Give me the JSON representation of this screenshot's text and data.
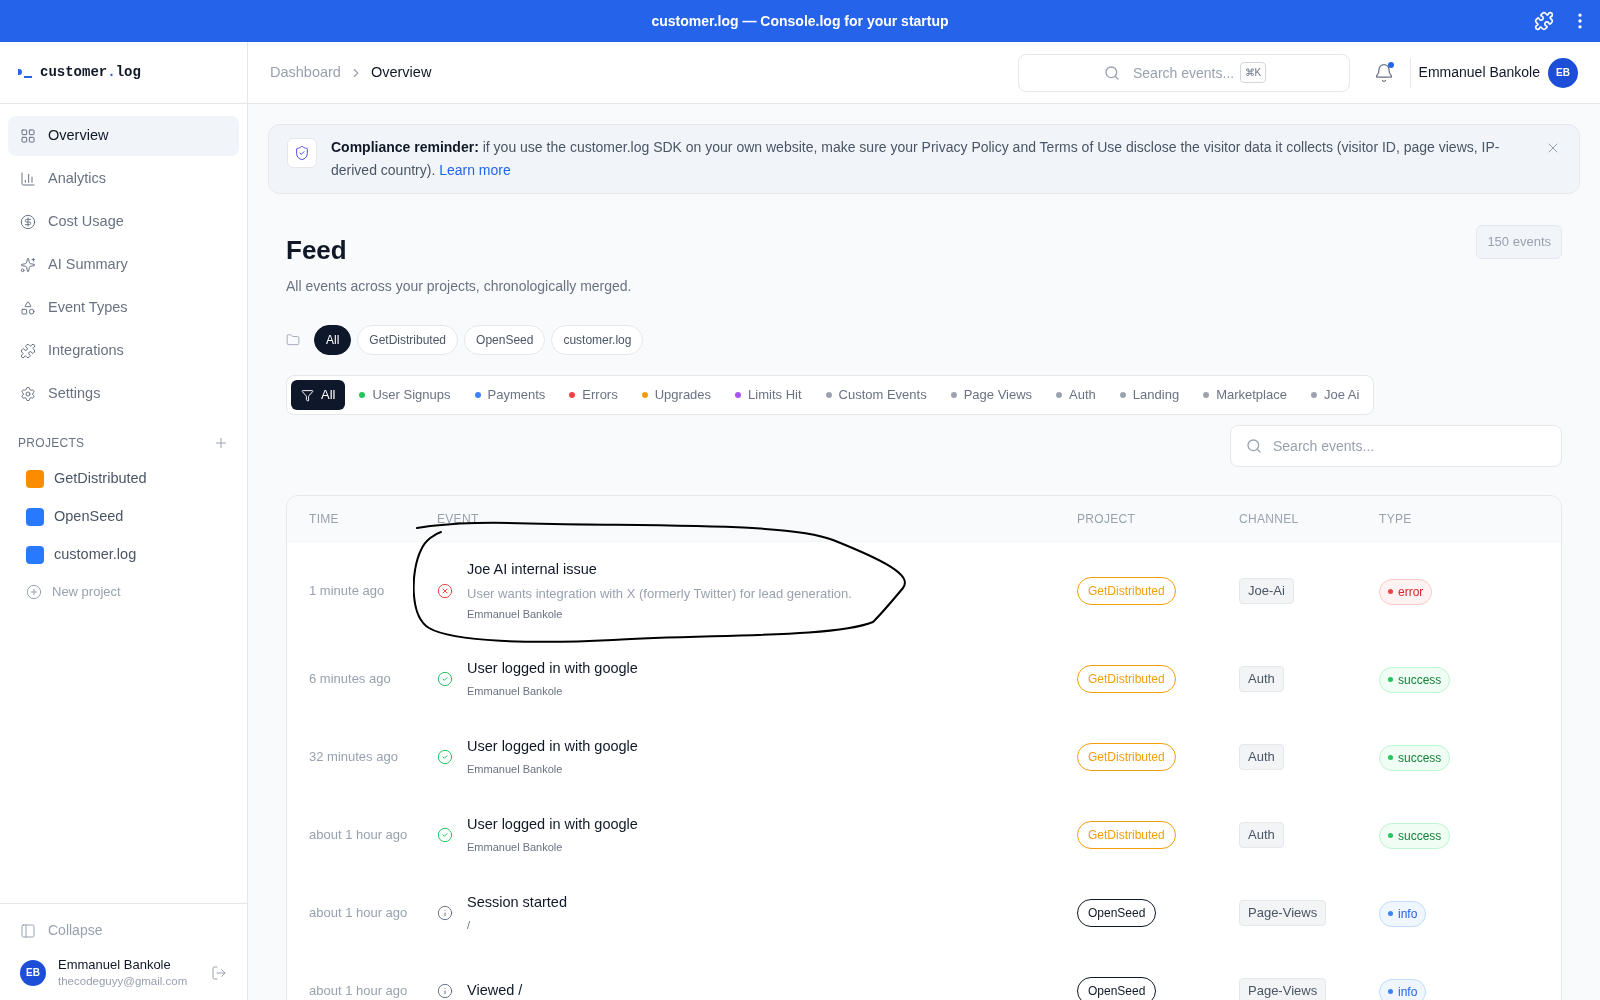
{
  "window": {
    "title": "customer.log — Console.log for your startup"
  },
  "brand": {
    "name": "customer",
    "dot": ".",
    "suffix": "log"
  },
  "sidebar": {
    "items": [
      {
        "label": "Overview",
        "selected": true
      },
      {
        "label": "Analytics",
        "selected": false
      },
      {
        "label": "Cost Usage",
        "selected": false
      },
      {
        "label": "AI Summary",
        "selected": false
      },
      {
        "label": "Event Types",
        "selected": false
      },
      {
        "label": "Integrations",
        "selected": false
      },
      {
        "label": "Settings",
        "selected": false
      }
    ],
    "projects_heading": "PROJECTS",
    "projects": [
      {
        "name": "GetDistributed",
        "color": "#fb8c00"
      },
      {
        "name": "OpenSeed",
        "color": "#2979ff"
      },
      {
        "name": "customer.log",
        "color": "#2979ff"
      }
    ],
    "new_project": "New project",
    "collapse": "Collapse",
    "user": {
      "initials": "EB",
      "name": "Emmanuel Bankole",
      "email": "thecodeguyy@gmail.com"
    }
  },
  "header": {
    "breadcrumbs": [
      "Dashboard",
      "Overview"
    ],
    "search": {
      "placeholder": "Search events...",
      "shortcut": "⌘K"
    },
    "notification_dot": true,
    "user": {
      "name": "Emmanuel Bankole",
      "initials": "EB"
    }
  },
  "banner": {
    "text": "**Compliance reminder:** if you use the customer.log SDK on your own website, make sure your Privacy Policy and Terms of Use disclose the visitor data it collects (visitor ID, page views, IP-derived country).",
    "link": "Learn more"
  },
  "feed": {
    "title": "Feed",
    "subtitle": "All events across your projects, chronologically merged.",
    "count": "150 events",
    "project_filters": [
      {
        "label": "All",
        "selected": true
      },
      {
        "label": "GetDistributed",
        "selected": false
      },
      {
        "label": "OpenSeed",
        "selected": false
      },
      {
        "label": "customer.log",
        "selected": false
      }
    ],
    "channel_filters": [
      {
        "label": "All",
        "selected": true
      },
      {
        "label": "User Signups",
        "color": "#22c55e",
        "selected": false
      },
      {
        "label": "Payments",
        "color": "#3b82f6",
        "selected": false
      },
      {
        "label": "Errors",
        "color": "#ef4444",
        "selected": false
      },
      {
        "label": "Upgrades",
        "color": "#f59e0b",
        "selected": false
      },
      {
        "label": "Limits Hit",
        "color": "#a855f7",
        "selected": false
      },
      {
        "label": "Custom Events",
        "color": "#9ca3af",
        "selected": false
      },
      {
        "label": "Page Views",
        "color": "#9ca3af",
        "selected": false
      },
      {
        "label": "Auth",
        "color": "#9ca3af",
        "selected": false
      },
      {
        "label": "Landing",
        "color": "#9ca3af",
        "selected": false
      },
      {
        "label": "Marketplace",
        "color": "#9ca3af",
        "selected": false
      },
      {
        "label": "Joe Ai",
        "color": "#9ca3af",
        "selected": false
      }
    ],
    "search": {
      "placeholder": "Search events..."
    }
  },
  "table": {
    "columns": [
      "TIME",
      "EVENT",
      "PROJECT",
      "CHANNEL",
      "TYPE"
    ],
    "rows": [
      {
        "time": "1 minute ago",
        "title": "Joe AI internal issue",
        "detail": "User wants integration with X (formerly Twitter) for lead generation.",
        "user": "Emmanuel Bankole",
        "project": "GetDistributed",
        "color": "#f59e0b",
        "channel": "Joe-Ai",
        "type": "error",
        "highlighted": true
      },
      {
        "time": "6 minutes ago",
        "title": "User logged in with google",
        "user": "Emmanuel Bankole",
        "project": "GetDistributed",
        "color": "#f59e0b",
        "channel": "Auth",
        "type": "success",
        "highlighted": false
      },
      {
        "time": "32 minutes ago",
        "title": "User logged in with google",
        "user": "Emmanuel Bankole",
        "project": "GetDistributed",
        "color": "#f59e0b",
        "channel": "Auth",
        "type": "success",
        "highlighted": false
      },
      {
        "time": "about 1 hour ago",
        "title": "User logged in with google",
        "user": "Emmanuel Bankole",
        "project": "GetDistributed",
        "color": "#f59e0b",
        "channel": "Auth",
        "type": "success",
        "highlighted": false
      },
      {
        "time": "about 1 hour ago",
        "title": "Session started",
        "user": "/",
        "project": "OpenSeed",
        "color": "#111827",
        "channel": "Page-Views",
        "type": "info",
        "highlighted": false
      },
      {
        "time": "about 1 hour ago",
        "title": "Viewed /",
        "project": "OpenSeed",
        "color": "#111827",
        "channel": "Page-Views",
        "type": "info",
        "highlighted": false
      }
    ]
  }
}
